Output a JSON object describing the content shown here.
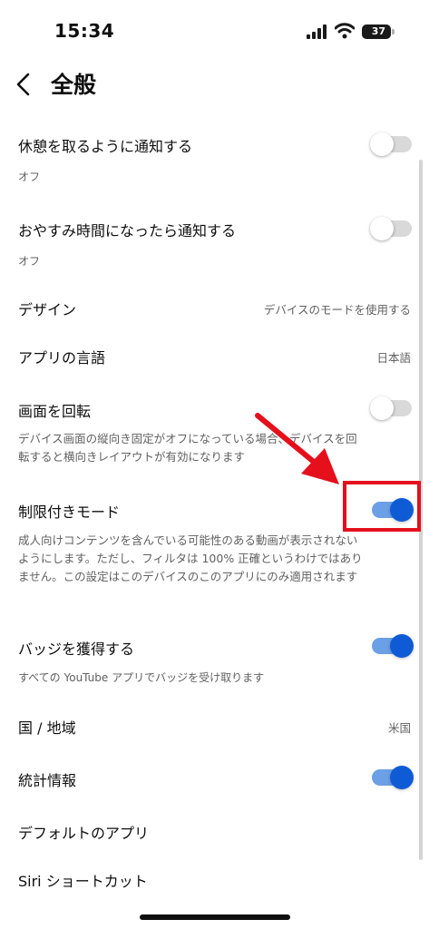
{
  "status_bar": {
    "time": "15:34",
    "battery": "37"
  },
  "header": {
    "title": "全般"
  },
  "settings": {
    "take_break": {
      "label": "休憩を取るように通知する",
      "sub": "オフ",
      "toggle": false
    },
    "bedtime": {
      "label": "おやすみ時間になったら通知する",
      "sub": "オフ",
      "toggle": false
    },
    "design": {
      "label": "デザイン",
      "value": "デバイスのモードを使用する"
    },
    "app_language": {
      "label": "アプリの言語",
      "value": "日本語"
    },
    "rotate": {
      "label": "画面を回転",
      "desc": "デバイス画面の縦向き固定がオフになっている場合、デバイスを回転すると横向きレイアウトが有効になります",
      "toggle": false
    },
    "restricted": {
      "label": "制限付きモード",
      "desc": "成人向けコンテンツを含んでいる可能性のある動画が表示されないようにします。ただし、フィルタは 100% 正確というわけではありません。この設定はこのデバイスのこのアプリにのみ適用されます",
      "toggle": true
    },
    "badges": {
      "label": "バッジを獲得する",
      "sub": "すべての YouTube アプリでバッジを受け取ります",
      "toggle": true
    },
    "region": {
      "label": "国 / 地域",
      "value": "米国"
    },
    "stats": {
      "label": "統計情報",
      "toggle": true
    },
    "default_apps": {
      "label": "デフォルトのアプリ"
    },
    "siri": {
      "label": "Siri ショートカット"
    }
  },
  "colors": {
    "toggle_on_track": "#6b9fe6",
    "toggle_on_knob": "#0f5bd6",
    "annotation_red": "#e5101c"
  }
}
